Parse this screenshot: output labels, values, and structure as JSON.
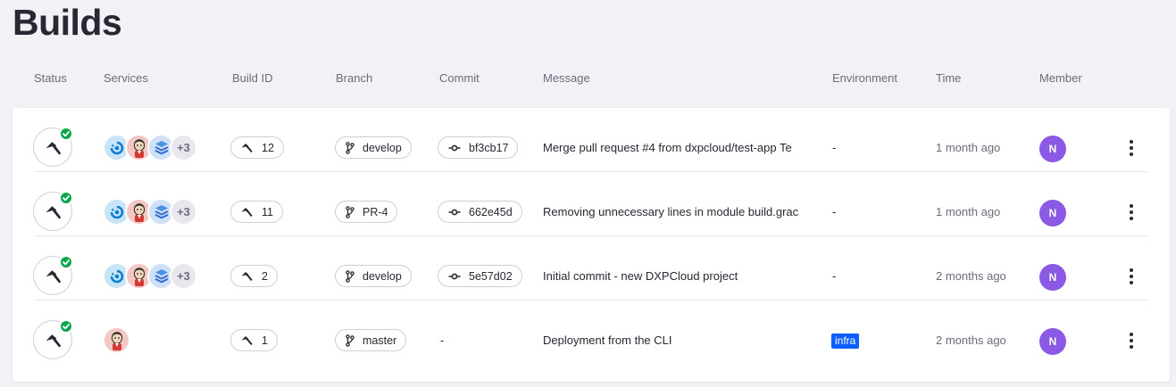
{
  "page": {
    "title": "Builds"
  },
  "columns": {
    "status": "Status",
    "services": "Services",
    "build_id": "Build ID",
    "branch": "Branch",
    "commit": "Commit",
    "message": "Message",
    "environment": "Environment",
    "time": "Time",
    "member": "Member"
  },
  "icons": {
    "build_status": "hammer-icon",
    "status_success": "check-circle-icon",
    "service_liferay": "liferay-icon",
    "service_jenkins": "jenkins-icon",
    "service_database": "database-icon",
    "build_id": "hammer-icon",
    "branch": "git-branch-icon",
    "commit": "git-commit-icon",
    "actions": "kebab-menu-icon"
  },
  "colors": {
    "success": "#0ba84a",
    "avatar": "#8b59e3",
    "env_badge": "#0b5fff"
  },
  "builds": [
    {
      "status": "success",
      "services_more": "+3",
      "build_id": "12",
      "branch": "develop",
      "commit": "bf3cb17",
      "message": "Merge pull request #4 from dxpcloud/test-app Te",
      "environment": "-",
      "time": "1 month ago",
      "member": "N"
    },
    {
      "status": "success",
      "services_more": "+3",
      "build_id": "11",
      "branch": "PR-4",
      "commit": "662e45d",
      "message": "Removing unnecessary lines in module build.grac",
      "environment": "-",
      "time": "1 month ago",
      "member": "N"
    },
    {
      "status": "success",
      "services_more": "+3",
      "build_id": "2",
      "branch": "develop",
      "commit": "5e57d02",
      "message": "Initial commit - new DXPCloud project",
      "environment": "-",
      "time": "2 months ago",
      "member": "N"
    },
    {
      "status": "success",
      "build_id": "1",
      "branch": "master",
      "commit": "-",
      "message": "Deployment from the CLI",
      "environment": "infra",
      "time": "2 months ago",
      "member": "N"
    }
  ]
}
